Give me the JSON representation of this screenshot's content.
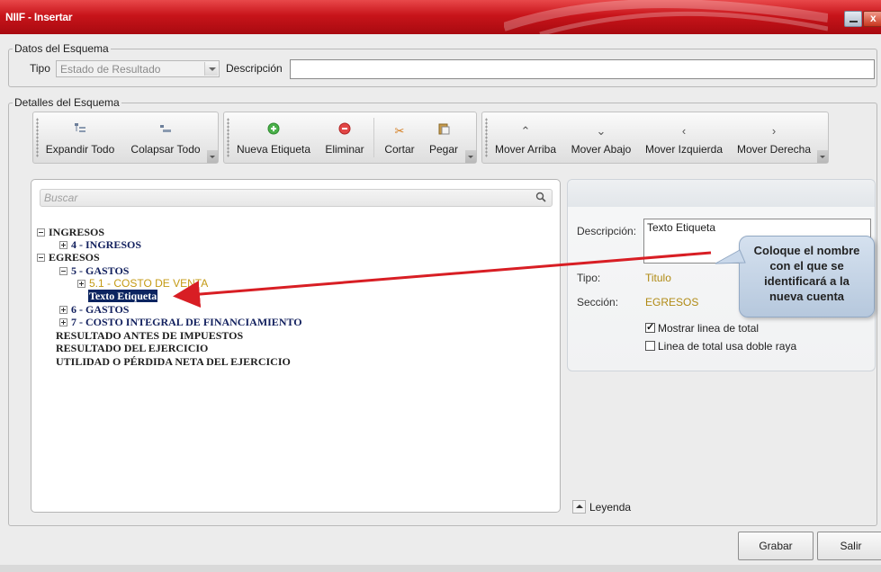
{
  "window": {
    "title": "NIIF - Insertar"
  },
  "schema_data": {
    "legend": "Datos del Esquema",
    "tipo_label": "Tipo",
    "tipo_value": "Estado de Resultado",
    "descripcion_label": "Descripción",
    "descripcion_value": ""
  },
  "details": {
    "legend": "Detalles del Esquema",
    "toolbar": {
      "expand": "Expandir Todo",
      "collapse": "Colapsar Todo",
      "new_label": "Nueva Etiqueta",
      "delete": "Eliminar",
      "cut": "Cortar",
      "paste": "Pegar",
      "move_up": "Mover Arriba",
      "move_down": "Mover Abajo",
      "move_left": "Mover Izquierda",
      "move_right": "Mover Derecha"
    },
    "search_placeholder": "Buscar",
    "tree": {
      "ingresos": "INGRESOS",
      "ingresos_4": "4 - INGRESOS",
      "egresos": "EGRESOS",
      "gastos_5": "5 - GASTOS",
      "costo_venta": "5.1 - COSTO DE VENTA",
      "texto_etiqueta": "Texto Etiqueta",
      "gastos_6": "6 - GASTOS",
      "costo_integral": "7 - COSTO INTEGRAL DE FINANCIAMIENTO",
      "resultado_antes": "RESULTADO ANTES DE IMPUESTOS",
      "resultado_ejercicio": "RESULTADO DEL EJERCICIO",
      "utilidad": "UTILIDAD O PÉRDIDA NETA DEL EJERCICIO"
    },
    "properties": {
      "descripcion_label": "Descripción:",
      "descripcion_value": "Texto Etiqueta",
      "tipo_label": "Tipo:",
      "tipo_value": "Titulo",
      "seccion_label": "Sección:",
      "seccion_value": "EGRESOS",
      "show_total_label": "Mostrar linea de total",
      "show_total_checked": true,
      "double_line_label": "Linea de total usa doble raya",
      "double_line_checked": false
    },
    "leyenda": "Leyenda"
  },
  "callout": {
    "line1": "Coloque el nombre",
    "line2": "con el que se",
    "line3": "identificará a la",
    "line4": "nueva cuenta"
  },
  "buttons": {
    "save": "Grabar",
    "exit": "Salir"
  },
  "colors": {
    "title_bar": "#c8141a",
    "tree_navy": "#12205e",
    "tree_gold": "#c49a14",
    "arrow": "#d81e24"
  }
}
